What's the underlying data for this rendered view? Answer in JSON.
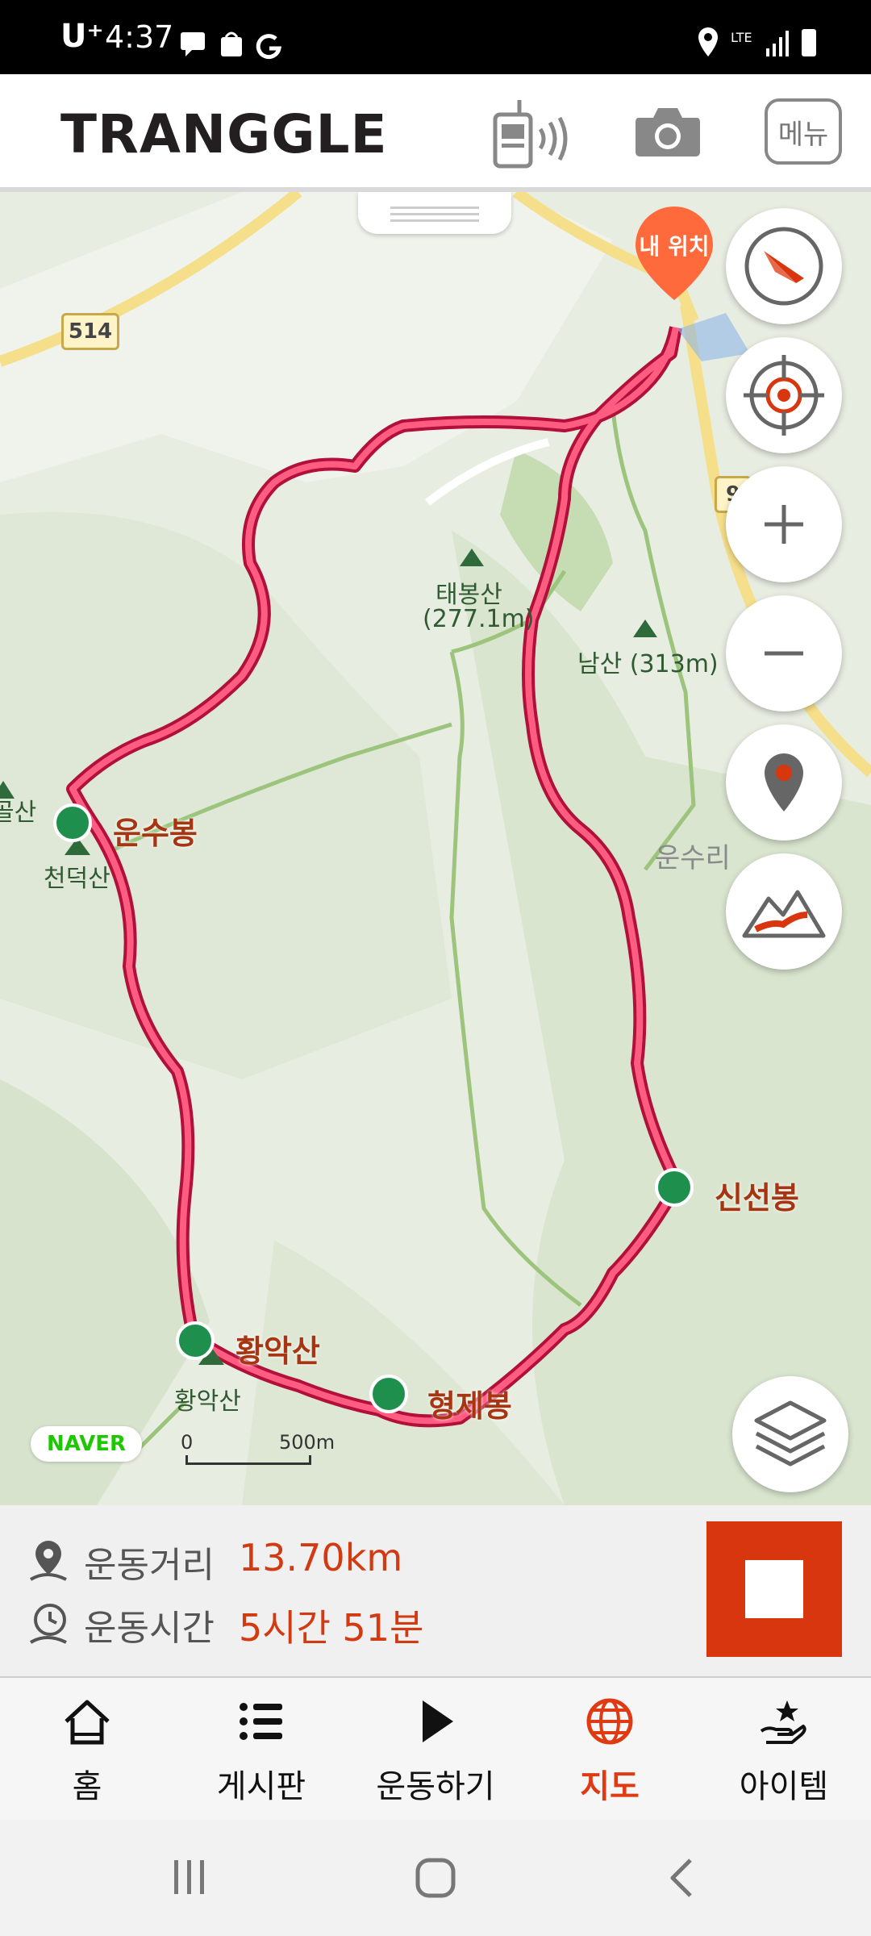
{
  "status_bar": {
    "carrier": "U⁺",
    "time": "4:37",
    "network": "LTE"
  },
  "header": {
    "logo": "TRANGGLE",
    "menu_label": "메뉴"
  },
  "map": {
    "my_location_label": "내 위치",
    "road_labels": [
      "514",
      "9"
    ],
    "peaks": [
      {
        "name": "운수봉"
      },
      {
        "name": "신선봉"
      },
      {
        "name": "황악산"
      },
      {
        "name": "형제봉"
      }
    ],
    "place_labels": {
      "taebongsan": "태봉산",
      "taebongsan_height": "(277.1m)",
      "namsan": "남산 (313m)",
      "cheondeoksan": "천덕산",
      "golsan": "골산",
      "unsuri": "운수리",
      "hwangaksan": "황악산"
    },
    "naver_label": "NAVER",
    "scale": {
      "start": "0",
      "end": "500m"
    }
  },
  "stats": {
    "distance_label": "운동거리",
    "distance_value": "13.70km",
    "time_label": "운동시간",
    "time_value": "5시간 51분"
  },
  "tabs": [
    {
      "label": "홈",
      "icon": "home-icon"
    },
    {
      "label": "게시판",
      "icon": "list-icon"
    },
    {
      "label": "운동하기",
      "icon": "play-icon"
    },
    {
      "label": "지도",
      "icon": "globe-icon",
      "active": true
    },
    {
      "label": "아이템",
      "icon": "item-hand-icon"
    }
  ],
  "colors": {
    "accent": "#d8360e",
    "route": "#f2275a",
    "active_tab": "#e03a12"
  }
}
